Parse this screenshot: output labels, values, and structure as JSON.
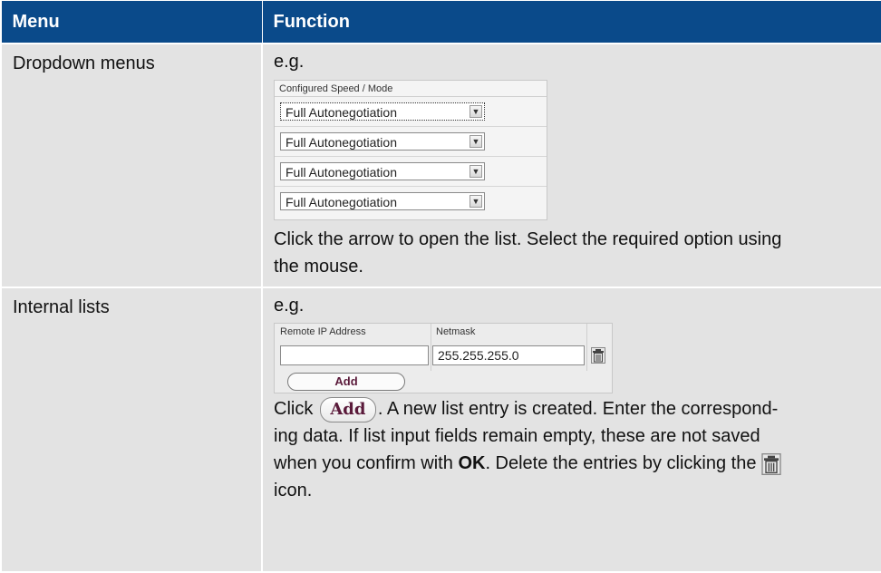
{
  "table": {
    "headers": [
      "Menu",
      "Function"
    ]
  },
  "row1": {
    "menu": "Dropdown menus",
    "eg": "e.g.",
    "sample_header": "Configured Speed / Mode",
    "options": [
      "Full Autonegotiation",
      "Full Autonegotiation",
      "Full Autonegotiation",
      "Full Autonegotiation"
    ],
    "desc_line1": "Click the arrow to open the list. Select the required option using",
    "desc_line2": "the mouse."
  },
  "row2": {
    "menu": "Internal lists",
    "eg": "e.g.",
    "col_remote_ip": "Remote IP Address",
    "col_netmask": "Netmask",
    "remote_ip_value": "",
    "netmask_value": "255.255.255.0",
    "add_label": "Add",
    "p1_pre": "Click",
    "inline_add_label": "Add",
    "p1_post": ". A new list entry is created. Enter the correspond-",
    "p2": "ing data. If list input fields remain empty, these are not saved",
    "p3_pre": "when you confirm with",
    "p3_ok": "OK",
    "p3_post": ". Delete the entries by clicking the",
    "p4": "icon."
  },
  "icons": [
    "chevron-down-icon",
    "trash-icon"
  ]
}
